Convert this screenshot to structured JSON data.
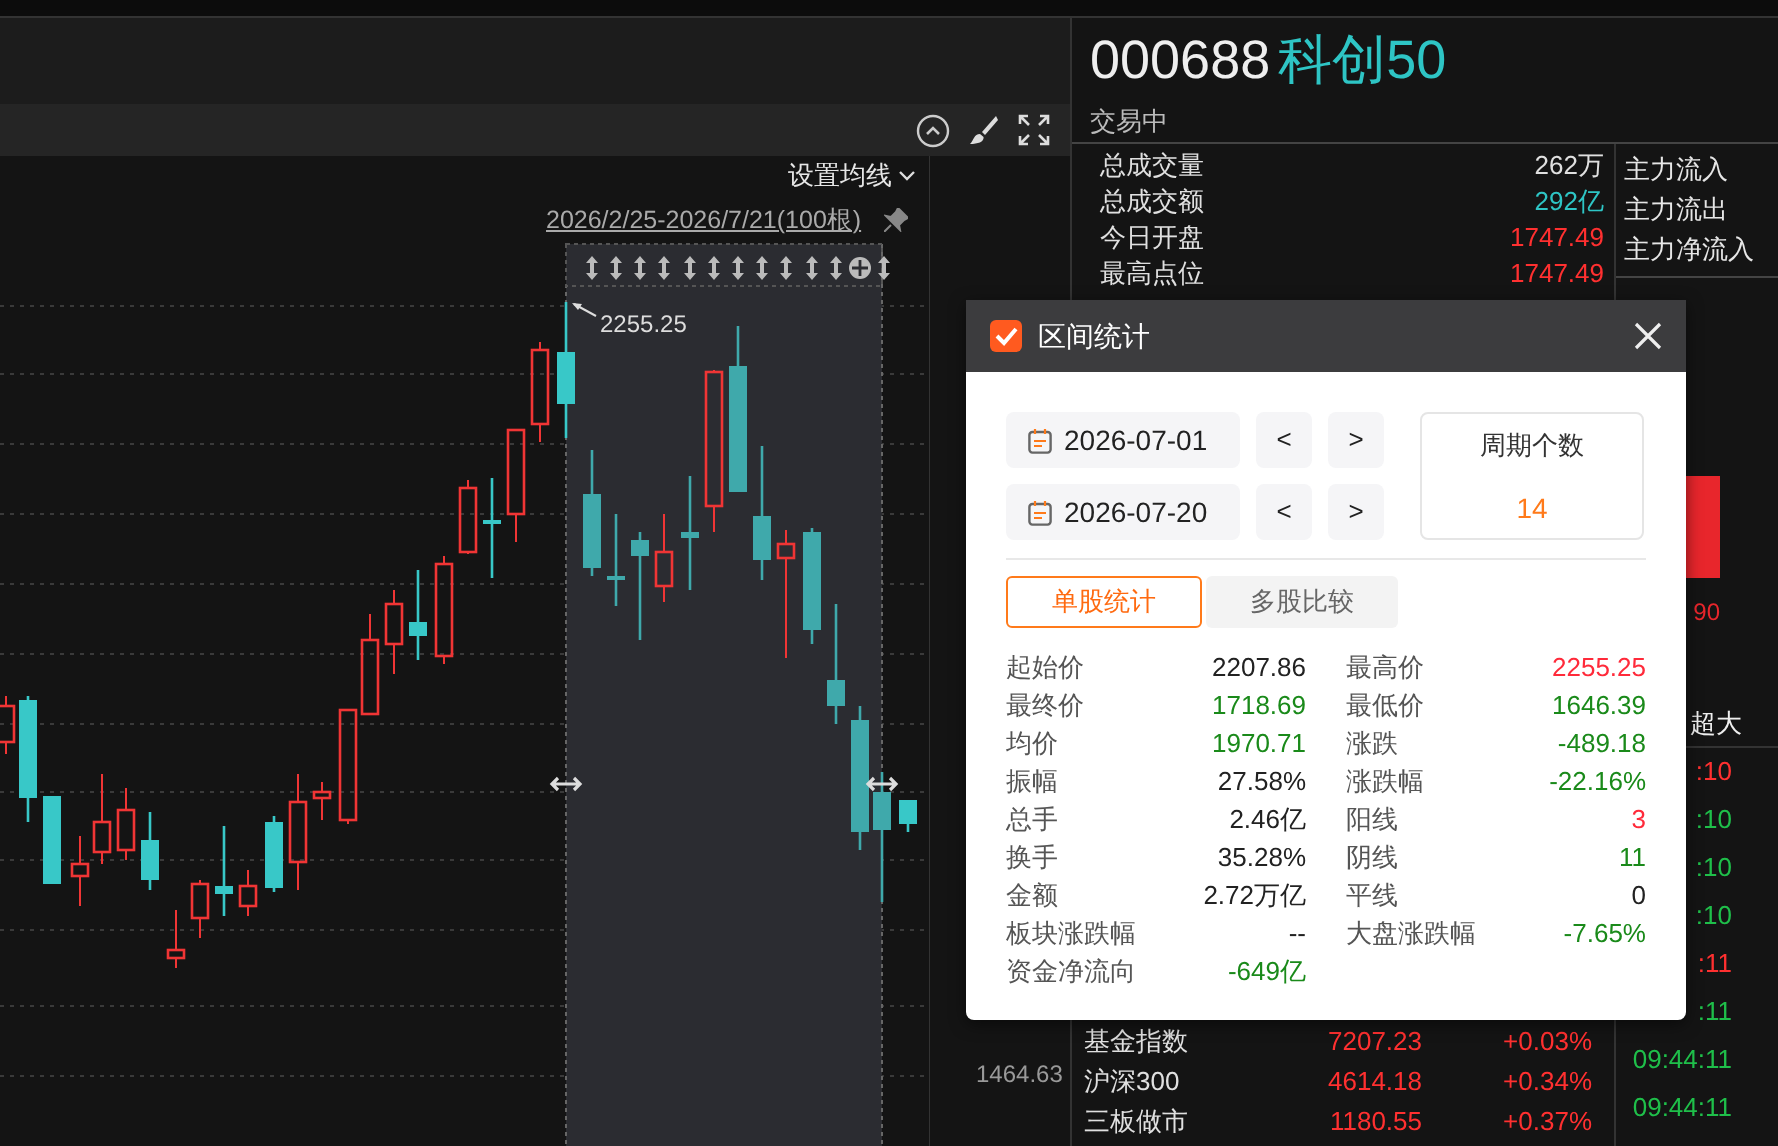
{
  "chart": {
    "ma_button": "设置均线",
    "range": "2026/2/25-2026/7/21(100根)",
    "max_label": "2255.25",
    "axis_labels": [
      "1464.63"
    ]
  },
  "quote": {
    "code": "000688",
    "name": "科创50",
    "status": "交易中",
    "stats": [
      {
        "label": "总成交量",
        "value": "262万",
        "color": "#e0e0e0"
      },
      {
        "label": "总成交额",
        "value": "292亿",
        "color": "#2ec5c5"
      },
      {
        "label": "今日开盘",
        "value": "1747.49",
        "color": "#ff3030"
      },
      {
        "label": "最高点位",
        "value": "1747.49",
        "color": "#ff3030"
      }
    ],
    "flows": [
      "主力流入",
      "主力流出",
      "主力净流入"
    ],
    "bar_label": "90",
    "flow_header": "超大",
    "times": [
      {
        "text": ":10",
        "color": "#ff3030"
      },
      {
        "text": ":10",
        "color": "#1fbf4a"
      },
      {
        "text": ":10",
        "color": "#1fbf4a"
      },
      {
        "text": ":10",
        "color": "#1fbf4a"
      },
      {
        "text": ":11",
        "color": "#ff3030"
      },
      {
        "text": ":11",
        "color": "#1fbf4a"
      },
      {
        "text": "09:44:11",
        "color": "#1fbf4a"
      },
      {
        "text": "09:44:11",
        "color": "#1fbf4a"
      }
    ],
    "indices": [
      {
        "name": "基金指数",
        "value": "7207.23",
        "change": "+0.03%",
        "color": "#ff3030"
      },
      {
        "name": "沪深300",
        "value": "4614.18",
        "change": "+0.34%",
        "color": "#ff3030"
      },
      {
        "name": "三板做市",
        "value": "1180.55",
        "change": "+0.37%",
        "color": "#ff3030"
      }
    ]
  },
  "dialog": {
    "title": "区间统计",
    "date_rows": [
      {
        "date": "2026-07-01",
        "prev": "<",
        "next": ">"
      },
      {
        "date": "2026-07-20",
        "prev": "<",
        "next": ">"
      }
    ],
    "count_label": "周期个数",
    "count": "14",
    "tabs": [
      {
        "label": "单股统计",
        "selected": true
      },
      {
        "label": "多股比较",
        "selected": false
      }
    ],
    "stats": [
      {
        "label": "起始价",
        "value": "2207.86",
        "color": "#222222"
      },
      {
        "label": "最高价",
        "value": "2255.25",
        "color": "#ff2a3a"
      },
      {
        "label": "最终价",
        "value": "1718.69",
        "color": "#1a8a1a"
      },
      {
        "label": "最低价",
        "value": "1646.39",
        "color": "#1a8a1a"
      },
      {
        "label": "均价",
        "value": "1970.71",
        "color": "#1a8a1a"
      },
      {
        "label": "涨跌",
        "value": "-489.18",
        "color": "#1a8a1a"
      },
      {
        "label": "振幅",
        "value": "27.58%",
        "color": "#222222"
      },
      {
        "label": "涨跌幅",
        "value": "-22.16%",
        "color": "#1a8a1a"
      },
      {
        "label": "总手",
        "value": "2.46亿",
        "color": "#222222"
      },
      {
        "label": "阳线",
        "value": "3",
        "color": "#ff2a3a"
      },
      {
        "label": "换手",
        "value": "35.28%",
        "color": "#222222"
      },
      {
        "label": "阴线",
        "value": "11",
        "color": "#1a8a1a"
      },
      {
        "label": "金额",
        "value": "2.72万亿",
        "color": "#222222"
      },
      {
        "label": "平线",
        "value": "0",
        "color": "#222222"
      },
      {
        "label": "板块涨跌幅",
        "value": "--",
        "color": "#222222"
      },
      {
        "label": "大盘涨跌幅",
        "value": "-7.65%",
        "color": "#1a8a1a"
      },
      {
        "label": "资金净流向",
        "value": "-649亿",
        "color": "#1a8a1a"
      }
    ]
  }
}
